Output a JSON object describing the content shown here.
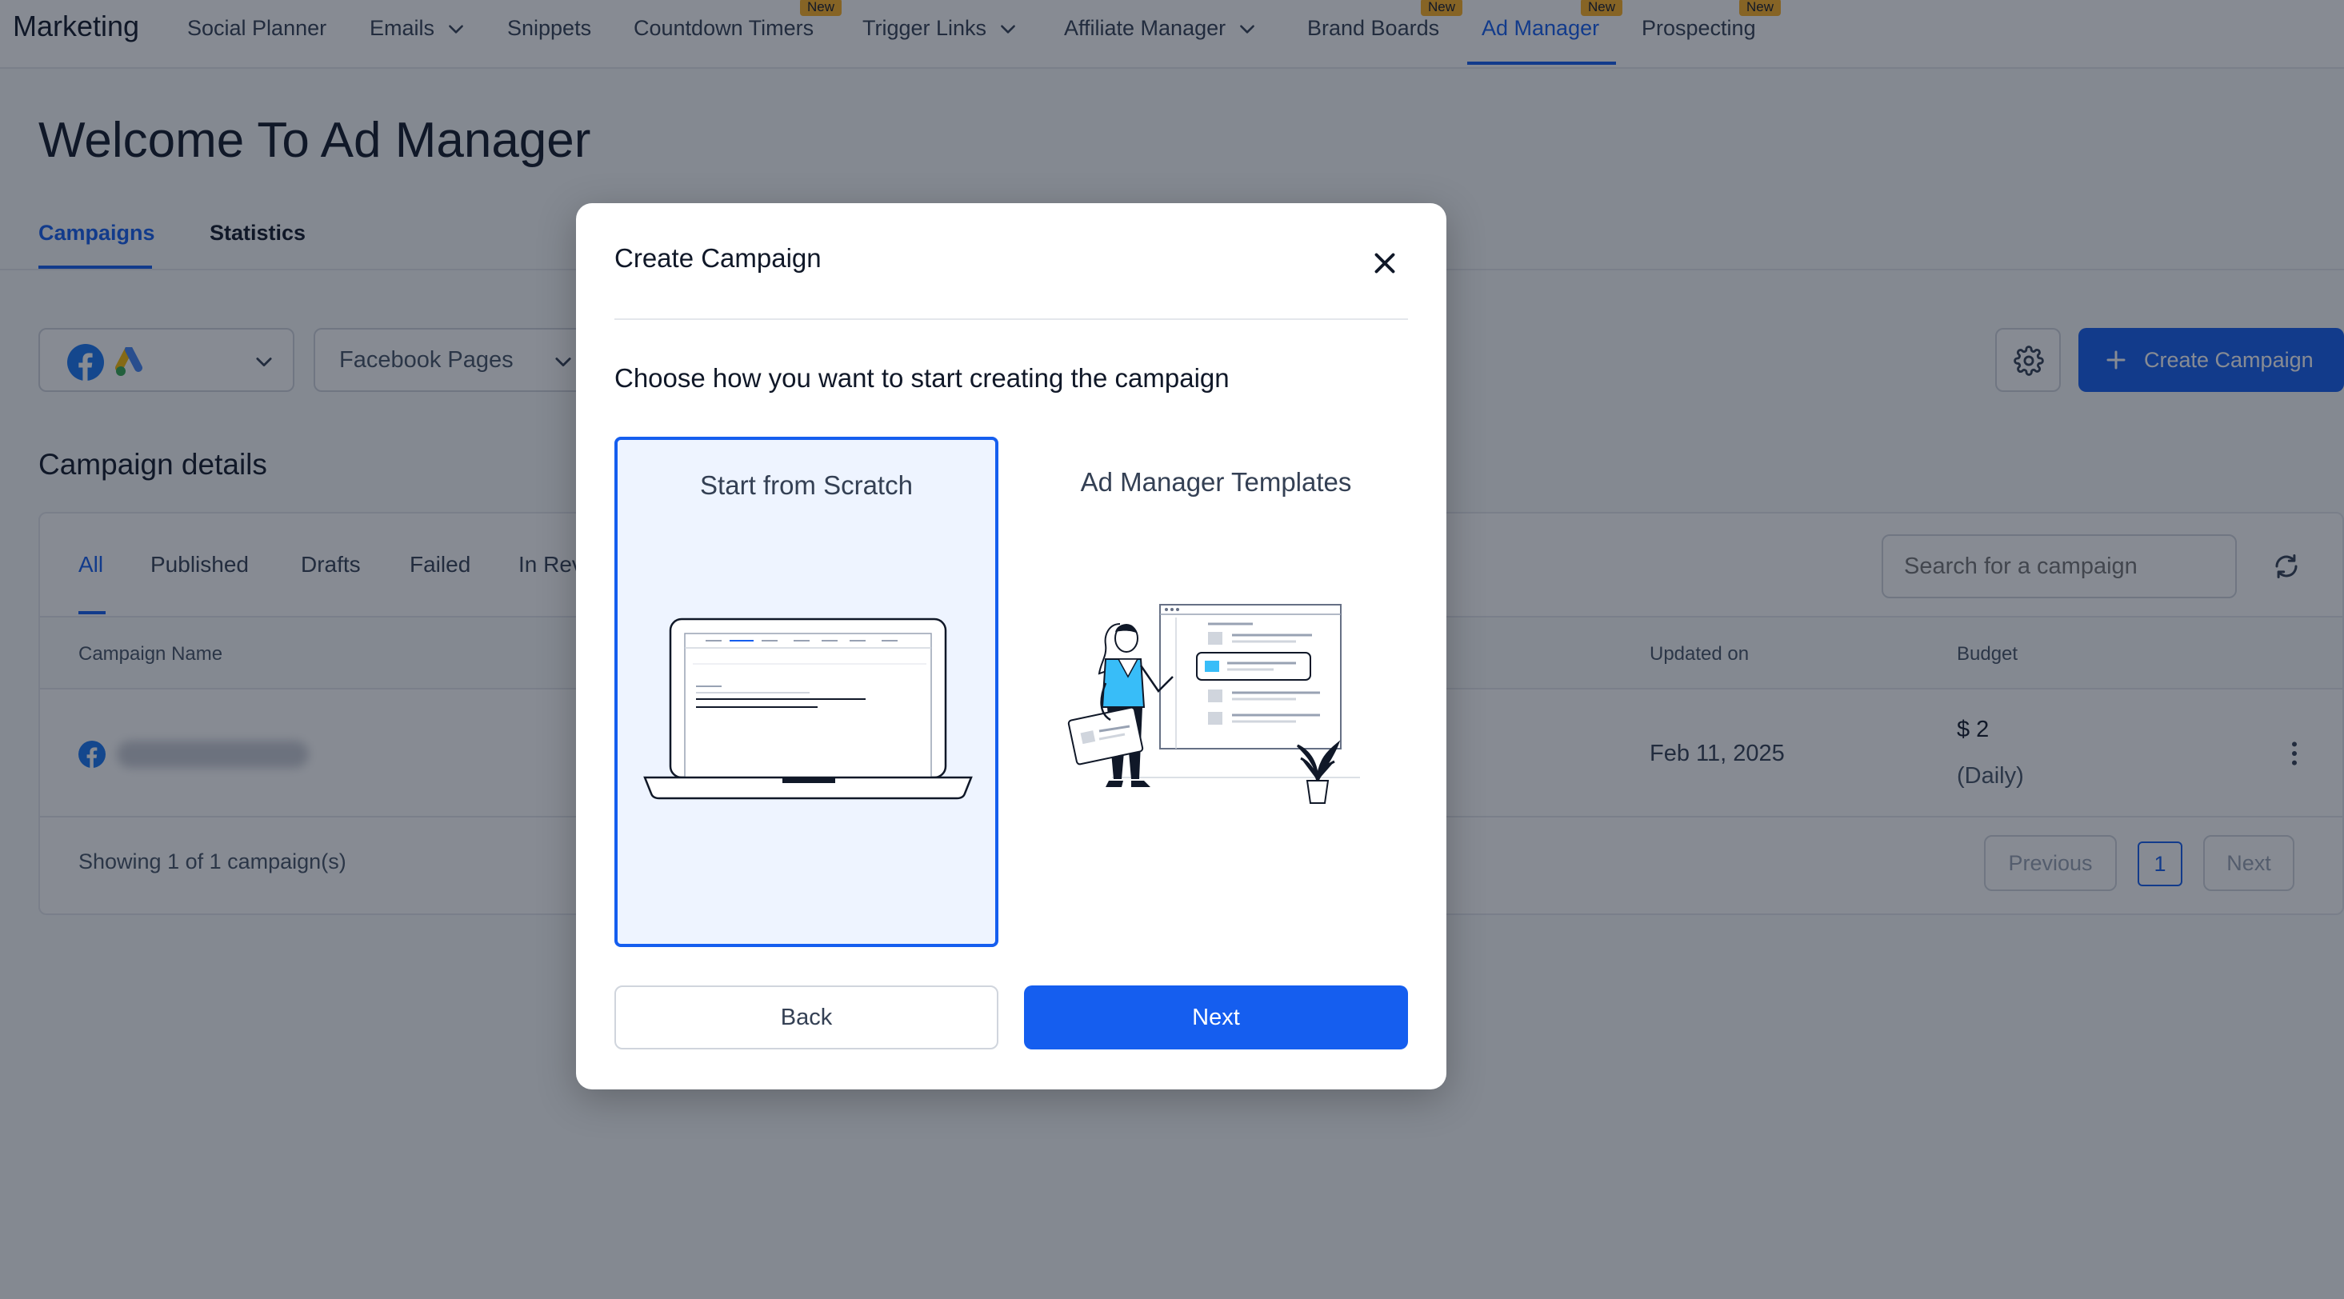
{
  "nav": {
    "brand": "Marketing",
    "items": [
      {
        "label": "Social Planner",
        "dropdown": false,
        "badge": ""
      },
      {
        "label": "Emails",
        "dropdown": true,
        "badge": ""
      },
      {
        "label": "Snippets",
        "dropdown": false,
        "badge": ""
      },
      {
        "label": "Countdown Timers",
        "dropdown": false,
        "badge": "New"
      },
      {
        "label": "Trigger Links",
        "dropdown": true,
        "badge": ""
      },
      {
        "label": "Affiliate Manager",
        "dropdown": true,
        "badge": ""
      },
      {
        "label": "Brand Boards",
        "dropdown": false,
        "badge": "New"
      },
      {
        "label": "Ad Manager",
        "dropdown": false,
        "badge": "New",
        "active": true
      },
      {
        "label": "Prospecting",
        "dropdown": false,
        "badge": "New"
      }
    ]
  },
  "page": {
    "title": "Welcome To Ad Manager",
    "tabs": [
      {
        "label": "Campaigns",
        "active": true
      },
      {
        "label": "Statistics",
        "active": false
      }
    ],
    "platform_select": {
      "icons": [
        "facebook-icon",
        "google-ads-icon"
      ]
    },
    "pages_select": {
      "value": "Facebook Pages"
    },
    "create_button": "Create Campaign",
    "section_title": "Campaign details",
    "filter_tabs": [
      "All",
      "Published",
      "Drafts",
      "Failed",
      "In Review"
    ],
    "search_placeholder": "Search for a campaign",
    "table": {
      "columns": [
        "Campaign Name",
        "Updated on",
        "Budget"
      ],
      "rows": [
        {
          "updated": "Feb 11, 2025",
          "budget": "$ 2",
          "budget_period": "(Daily)"
        }
      ]
    },
    "footer": {
      "showing": "Showing 1 of 1 campaign(s)",
      "previous": "Previous",
      "page": "1",
      "next": "Next"
    }
  },
  "modal": {
    "title": "Create Campaign",
    "subtitle": "Choose how you want to start creating the campaign",
    "options": [
      {
        "label": "Start from Scratch",
        "selected": true
      },
      {
        "label": "Ad Manager Templates",
        "selected": false
      }
    ],
    "back": "Back",
    "next": "Next"
  },
  "colors": {
    "primary": "#155eef",
    "badge": "#fdb022",
    "overlay": "rgba(16,24,40,0.5)"
  }
}
